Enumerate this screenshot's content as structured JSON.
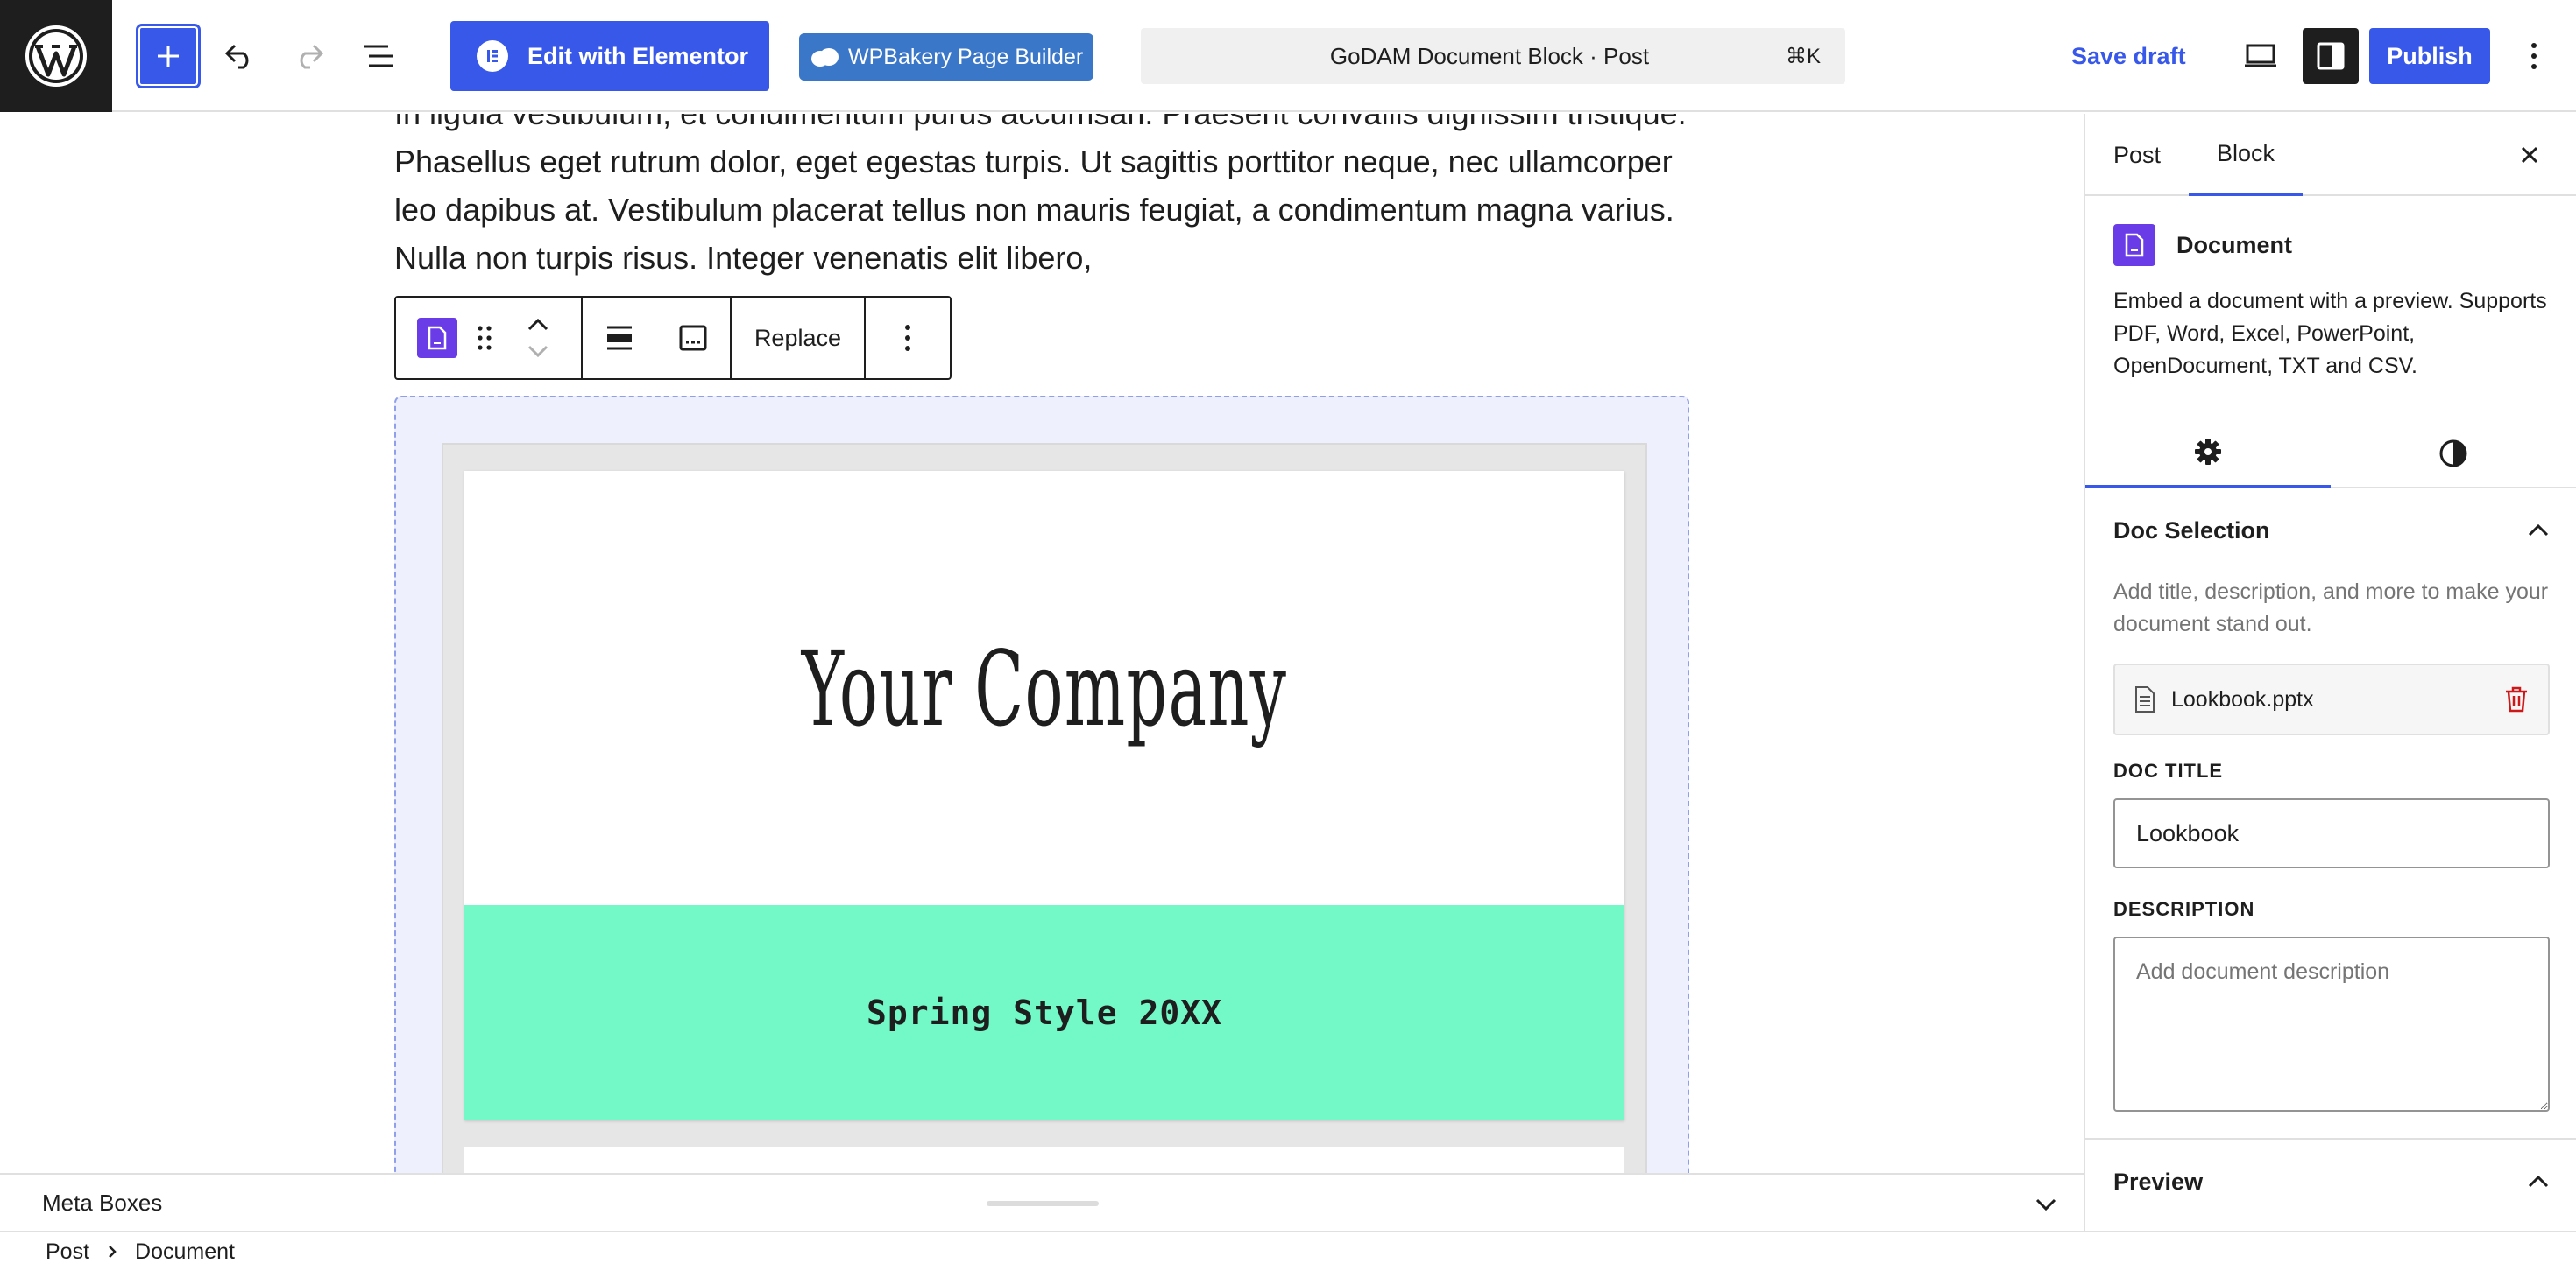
{
  "topbar": {
    "elementor_label": "Edit with Elementor",
    "wpbakery_label": "WPBakery Page Builder",
    "command_title": "GoDAM Document Block · Post",
    "command_shortcut": "⌘K",
    "save_draft_label": "Save draft",
    "publish_label": "Publish"
  },
  "editor": {
    "paragraph": "In ligula vestibulum, et condimentum purus accumsan. Praesent convallis dignissim tristique. Phasellus eget rutrum dolor, eget egestas turpis. Ut sagittis porttitor neque, nec ullamcorper leo dapibus at. Vestibulum placerat tellus non mauris feugiat, a condimentum magna varius. Nulla non turpis risus. Integer venenatis elit libero,",
    "toolbar": {
      "replace_label": "Replace"
    },
    "document_preview": {
      "slide_title": "Your Company",
      "slide_subtitle": "Spring Style 20XX",
      "band_color": "#73f9c8"
    }
  },
  "sidebar": {
    "tabs": [
      {
        "label": "Post"
      },
      {
        "label": "Block"
      }
    ],
    "block": {
      "title": "Document",
      "description": "Embed a document with a preview. Supports PDF, Word, Excel, PowerPoint, OpenDocument, TXT and CSV."
    },
    "doc_selection": {
      "title": "Doc Selection",
      "help": "Add title, description, and more to make your document stand out.",
      "file_name": "Lookbook.pptx",
      "title_label": "Doc Title",
      "title_value": "Lookbook",
      "description_label": "Description",
      "description_placeholder": "Add document description"
    },
    "preview_title": "Preview"
  },
  "meta_boxes": {
    "label": "Meta Boxes"
  },
  "breadcrumb": [
    "Post",
    "Document"
  ],
  "colors": {
    "accent": "#3858e9",
    "block_icon": "#6a3ce8",
    "danger": "#cc1818"
  }
}
